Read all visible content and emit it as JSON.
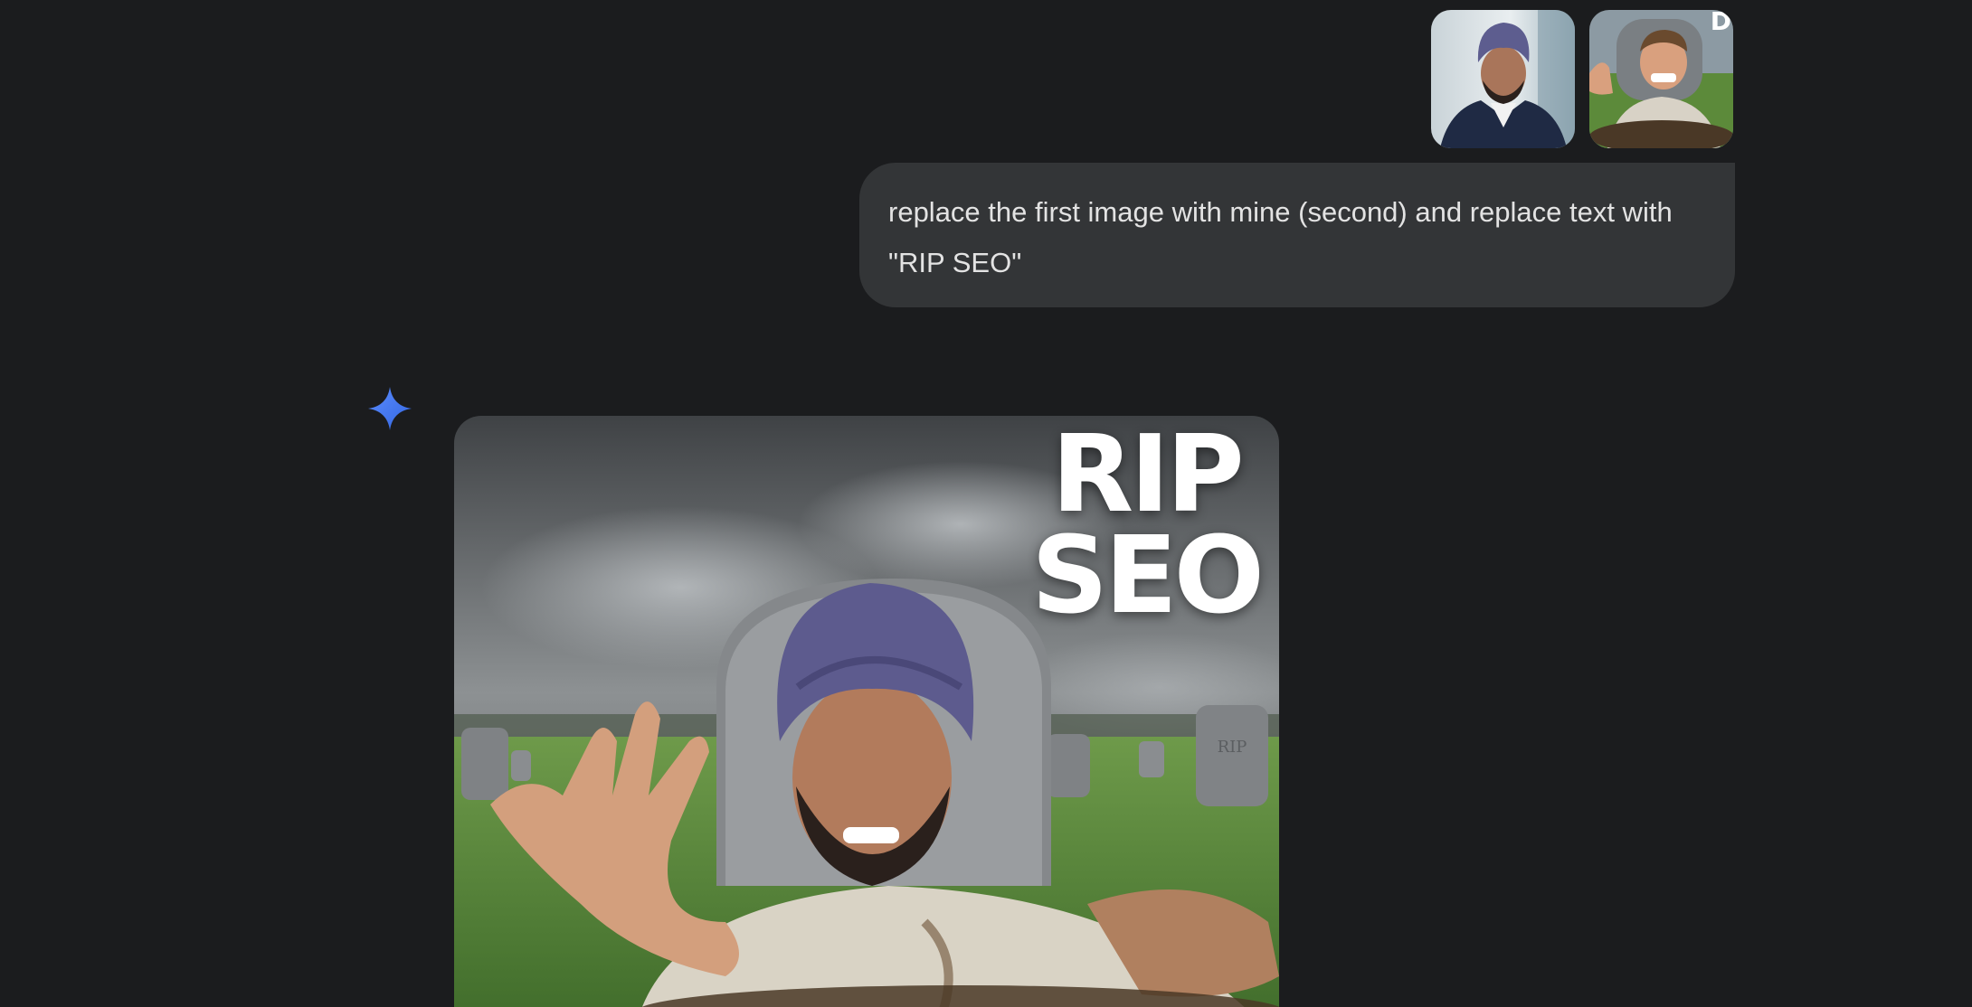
{
  "conversation": {
    "user_message": {
      "attachments": [
        {
          "name": "attachment-1",
          "alt": "professional headshot"
        },
        {
          "name": "attachment-2",
          "alt": "thumbnail to edit",
          "corner_text": "D"
        }
      ],
      "text": "replace the first image with mine (second) and replace text with \"RIP SEO\""
    },
    "assistant_message": {
      "icon": "gemini-spark-icon",
      "image": {
        "headline_line1": "RIP",
        "headline_line2": "SEO",
        "tombstone_text": "RIP"
      }
    }
  },
  "colors": {
    "background": "#1b1c1e",
    "user_bubble": "#333537",
    "user_text": "#e3e3e3",
    "spark_blue": "#4d7ff0"
  }
}
